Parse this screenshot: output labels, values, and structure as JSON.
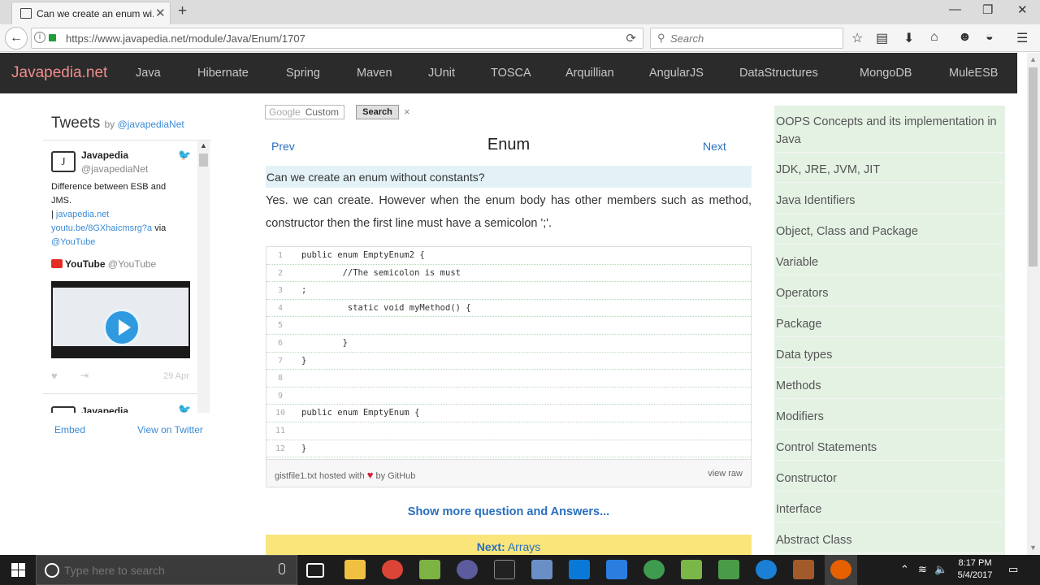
{
  "browser": {
    "tab_title": "Can we create an enum wi...",
    "url": "https://www.javapedia.net/module/Java/Enum/1707",
    "search_placeholder": "Search"
  },
  "site": {
    "logo": "Javapedia.net",
    "nav": [
      "Java",
      "Hibernate",
      "Spring",
      "Maven",
      "JUnit",
      "TOSCA",
      "Arquillian",
      "AngularJS",
      "DataStructures",
      "MongoDB",
      "MuleESB"
    ]
  },
  "twitter": {
    "title": "Tweets",
    "by": "by ",
    "by_handle": "@javapediaNet",
    "tweet": {
      "name": "Javapedia",
      "handle": "@javapediaNet",
      "text_line1": "Difference between ESB and JMS.",
      "text_line2": "| ",
      "link": "javapedia.net",
      "link2": "youtu.be/8GXhaicmsrg?a",
      "via": " via",
      "mention": "@YouTube",
      "card_name": "YouTube",
      "card_handle": "@YouTube",
      "date": "29 Apr"
    },
    "next_tweet_name": "Javapedia",
    "embed": "Embed",
    "view_on_twitter": "View on Twitter"
  },
  "google_search": {
    "google": "Google",
    "custom": "Custom",
    "button": "Search",
    "close": "×"
  },
  "article": {
    "prev": "Prev",
    "title": "Enum",
    "next": "Next",
    "question": "Can we create an enum without constants?",
    "answer": "Yes. we can create. However when the enum body has other members such as method, constructor then the first line must have a semicolon ';'."
  },
  "gist": {
    "lines": [
      {
        "n": "1",
        "code": "public enum EmptyEnum2 {"
      },
      {
        "n": "2",
        "code": "        //The semicolon is must"
      },
      {
        "n": "3",
        "code": ";"
      },
      {
        "n": "4",
        "code": "         static void myMethod() {"
      },
      {
        "n": "5",
        "code": ""
      },
      {
        "n": "6",
        "code": "        }"
      },
      {
        "n": "7",
        "code": "}"
      },
      {
        "n": "8",
        "code": ""
      },
      {
        "n": "9",
        "code": ""
      },
      {
        "n": "10",
        "code": "public enum EmptyEnum {"
      },
      {
        "n": "11",
        "code": ""
      },
      {
        "n": "12",
        "code": "}"
      }
    ],
    "file": "gistfile1.txt",
    "hosted": " hosted with ",
    "by": " by GitHub",
    "view_raw": "view raw"
  },
  "show_more": "Show more question and Answers...",
  "next_bar": {
    "label": "Next:",
    "target": "Arrays"
  },
  "sidebar": {
    "items": [
      "OOPS Concepts and its implementation in Java",
      "JDK, JRE, JVM, JIT",
      "Java Identifiers",
      "Object, Class and Package",
      "Variable",
      "Operators",
      "Package",
      "Data types",
      "Methods",
      "Modifiers",
      "Control Statements",
      "Constructor",
      "Interface",
      "Abstract Class"
    ]
  },
  "taskbar": {
    "search_placeholder": "Type here to search",
    "time": "8:17 PM",
    "date": "5/4/2017"
  },
  "colors": {
    "header_bg": "#2b2b2b",
    "logo": "#f08c8c",
    "link": "#2a6fbf",
    "question_bg": "#e3f2f7",
    "sidebar_bg": "#e4f2e4",
    "next_bar_bg": "#f9e57a"
  }
}
